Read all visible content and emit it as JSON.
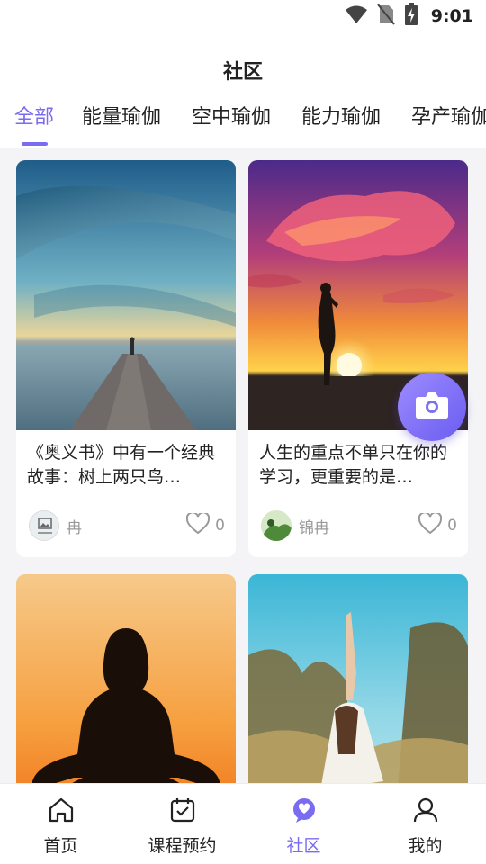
{
  "status_bar": {
    "time": "9:01"
  },
  "header": {
    "title": "社区",
    "tabs": [
      {
        "label": "全部",
        "active": true
      },
      {
        "label": "能量瑜伽",
        "active": false
      },
      {
        "label": "空中瑜伽",
        "active": false
      },
      {
        "label": "能力瑜伽",
        "active": false
      },
      {
        "label": "孕产瑜伽",
        "active": false
      }
    ]
  },
  "feed": {
    "posts": [
      {
        "image": "sunset-pier-photo",
        "text": "《奥义书》中有一个经典故事：树上两只鸟…",
        "author": "冉",
        "likes": "0"
      },
      {
        "image": "yoga-silhouette-sunset-photo",
        "text": "人生的重点不单只在你的学习，更重要的是…",
        "author": "锦冉",
        "likes": "0"
      },
      {
        "image": "meditation-silhouette-photo",
        "text": "",
        "author": "",
        "likes": ""
      },
      {
        "image": "yoga-arm-raised-field-photo",
        "text": "",
        "author": "",
        "likes": ""
      }
    ]
  },
  "bottom_nav": {
    "items": [
      {
        "label": "首页",
        "icon": "home-icon",
        "active": false
      },
      {
        "label": "课程预约",
        "icon": "calendar-check-icon",
        "active": false
      },
      {
        "label": "社区",
        "icon": "community-chat-icon",
        "active": true
      },
      {
        "label": "我的",
        "icon": "user-icon",
        "active": false
      }
    ]
  },
  "colors": {
    "accent": "#7a6cf0"
  }
}
